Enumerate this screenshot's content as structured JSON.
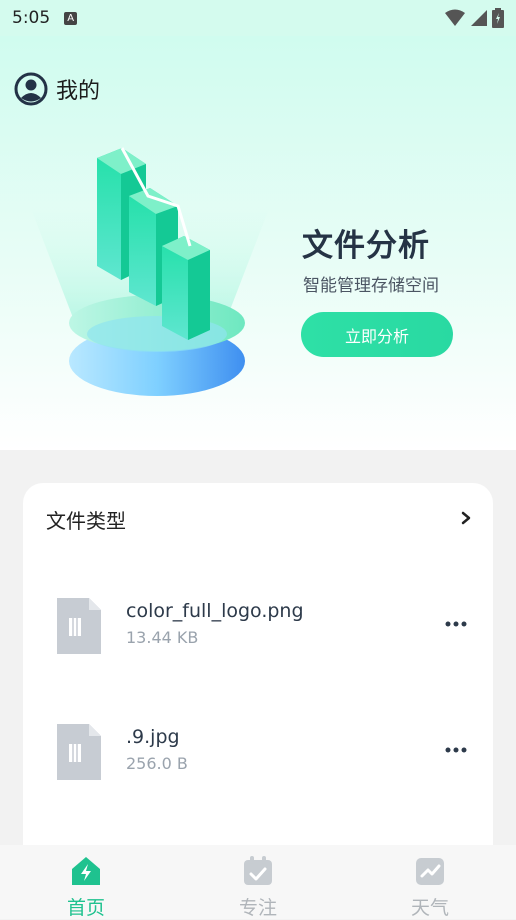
{
  "status_bar": {
    "time": "5:05",
    "notification_badge": "A"
  },
  "header": {
    "profile_label": "我的"
  },
  "hero": {
    "title": "文件分析",
    "subtitle": "智能管理存储空间",
    "button_label": "立即分析"
  },
  "file_types": {
    "title": "文件类型",
    "files": [
      {
        "name": "color_full_logo.png",
        "size": "13.44 KB"
      },
      {
        "name": ".9.jpg",
        "size": "256.0 B"
      }
    ]
  },
  "tabbar": {
    "tabs": [
      {
        "label": "首页",
        "icon": "home-icon",
        "active": true
      },
      {
        "label": "专注",
        "icon": "calendar-icon",
        "active": false
      },
      {
        "label": "天气",
        "icon": "weather-chart-icon",
        "active": false
      }
    ],
    "active_color": "#1fc28f",
    "inactive_color": "#bfc4c9"
  },
  "colors": {
    "accent": "#2ee0a6",
    "hero_bg": "#d4fbee"
  }
}
